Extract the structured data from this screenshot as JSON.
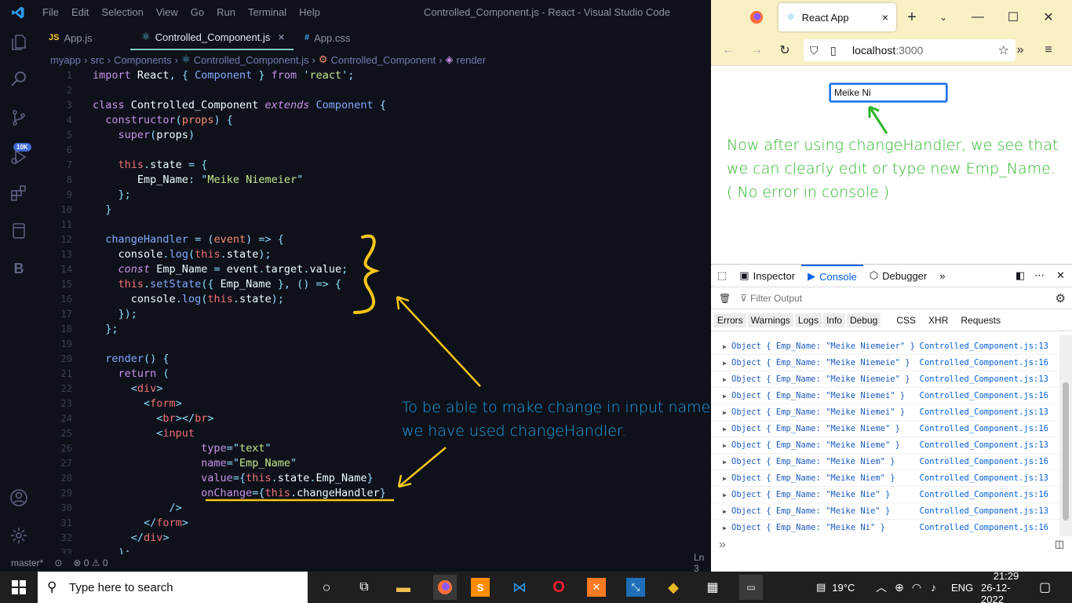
{
  "vscode": {
    "menu": [
      "File",
      "Edit",
      "Selection",
      "View",
      "Go",
      "Run",
      "Terminal",
      "Help"
    ],
    "window_title": "Controlled_Component.js - React - Visual Studio Code",
    "badge": "10K",
    "tabs": [
      {
        "icon": "JS",
        "label": "App.js"
      },
      {
        "icon": "⚛",
        "label": "Controlled_Component.js",
        "close": "×"
      },
      {
        "icon": "#",
        "label": "App.css"
      }
    ],
    "breadcrumb": [
      "myapp",
      "src",
      "Components",
      "Controlled_Component.js",
      "Controlled_Component",
      "render"
    ],
    "line_numbers": [
      "1",
      "2",
      "3",
      "4",
      "5",
      "6",
      "7",
      "8",
      "9",
      "10",
      "11",
      "12",
      "13",
      "14",
      "15",
      "16",
      "17",
      "18",
      "19",
      "20",
      "21",
      "22",
      "23",
      "24",
      "25",
      "26",
      "27",
      "28",
      "29",
      "30",
      "31",
      "32",
      "33"
    ],
    "status": {
      "branch": "master*",
      "problems": "⊗ 0 ⚠ 0",
      "position": "Ln 3"
    },
    "colors": {
      "bg": "#0f111a",
      "accent": "#80cbc4"
    }
  },
  "firefox": {
    "tab_title": "React App",
    "tab_close": "×",
    "url_host": "localhost",
    "url_port": ":3000",
    "input_value": "Meike Ni",
    "devtools": {
      "tabs": [
        "Inspector",
        "Console",
        "Debugger"
      ],
      "filter_placeholder": "Filter Output",
      "categories": [
        "Errors",
        "Warnings",
        "Logs",
        "Info",
        "Debug"
      ],
      "categories_plain": [
        "CSS",
        "XHR",
        "Requests"
      ],
      "logs": [
        {
          "text": "Object { Emp_Name: \"Meike Niemeier\" }",
          "src": "Controlled_Component.js:13"
        },
        {
          "text": "Object { Emp_Name: \"Meike Niemeie\" }",
          "src": "Controlled_Component.js:16"
        },
        {
          "text": "Object { Emp_Name: \"Meike Niemeie\" }",
          "src": "Controlled_Component.js:13"
        },
        {
          "text": "Object { Emp_Name: \"Meike Niemei\" }",
          "src": "Controlled_Component.js:16"
        },
        {
          "text": "Object { Emp_Name: \"Meike Niemei\" }",
          "src": "Controlled_Component.js:13"
        },
        {
          "text": "Object { Emp_Name: \"Meike Nieme\" }",
          "src": "Controlled_Component.js:16"
        },
        {
          "text": "Object { Emp_Name: \"Meike Nieme\" }",
          "src": "Controlled_Component.js:13"
        },
        {
          "text": "Object { Emp_Name: \"Meike Niem\" }",
          "src": "Controlled_Component.js:16"
        },
        {
          "text": "Object { Emp_Name: \"Meike Niem\" }",
          "src": "Controlled_Component.js:13"
        },
        {
          "text": "Object { Emp_Name: \"Meike Nie\" }",
          "src": "Controlled_Component.js:16"
        },
        {
          "text": "Object { Emp_Name: \"Meike Nie\" }",
          "src": "Controlled_Component.js:13"
        },
        {
          "text": "Object { Emp_Name: \"Meike Ni\" }",
          "src": "Controlled_Component.js:16"
        }
      ],
      "prompt": "»"
    }
  },
  "annotations": {
    "green_note": "Now after using changeHandler, we see that we can clearly edit or type new Emp_Name. ( No error in console )",
    "blue_note": "To be able to make change in input name we have used changeHandler."
  },
  "taskbar": {
    "search_placeholder": "Type here to search",
    "weather": "19°C",
    "lang": "ENG",
    "time": "21:29",
    "date": "26-12-2022"
  }
}
